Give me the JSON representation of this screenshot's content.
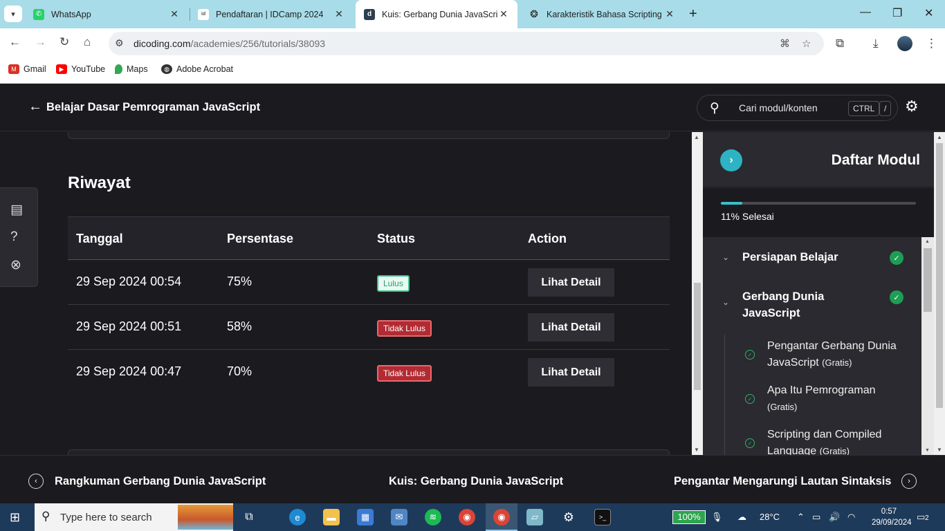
{
  "browser": {
    "tabs": [
      {
        "title": "WhatsApp",
        "icon": "whatsapp-icon",
        "active": false
      },
      {
        "title": "Pendaftaran | IDCamp 2024",
        "icon": "idcamp-icon",
        "active": false
      },
      {
        "title": "Kuis: Gerbang Dunia JavaScript",
        "icon": "dicoding-icon",
        "active": true
      },
      {
        "title": "Karakteristik Bahasa Scripting",
        "icon": "openai-icon",
        "active": false
      }
    ],
    "url_host": "dicoding.com",
    "url_path": "/academies/256/tutorials/38093",
    "bookmarks": [
      {
        "label": "Gmail",
        "icon": "gmail-icon",
        "color": "#d93025"
      },
      {
        "label": "YouTube",
        "icon": "youtube-icon",
        "color": "#ff0000"
      },
      {
        "label": "Maps",
        "icon": "maps-icon",
        "color": "#34a853"
      },
      {
        "label": "Adobe Acrobat",
        "icon": "globe-icon",
        "color": "#333333"
      }
    ]
  },
  "header": {
    "course_title": "Belajar Dasar Pemrograman JavaScript",
    "search_placeholder": "Cari modul/konten",
    "kbd_ctrl": "CTRL",
    "kbd_slash": "/"
  },
  "history": {
    "title": "Riwayat",
    "columns": [
      "Tanggal",
      "Persentase",
      "Status",
      "Action"
    ],
    "rows": [
      {
        "date": "29 Sep 2024 00:54",
        "percent": "75%",
        "status": "Lulus",
        "passed": true,
        "action": "Lihat Detail"
      },
      {
        "date": "29 Sep 2024 00:51",
        "percent": "58%",
        "status": "Tidak Lulus",
        "passed": false,
        "action": "Lihat Detail"
      },
      {
        "date": "29 Sep 2024 00:47",
        "percent": "70%",
        "status": "Tidak Lulus",
        "passed": false,
        "action": "Lihat Detail"
      }
    ]
  },
  "sidebar": {
    "title": "Daftar Modul",
    "progress": 0.11,
    "progress_label": "11% Selesai",
    "modules": [
      {
        "name": "Persiapan Belajar",
        "done": true
      },
      {
        "name": "Gerbang Dunia JavaScript",
        "done": true
      }
    ],
    "submodules": [
      {
        "name": "Pengantar Gerbang Dunia JavaScript",
        "tag": "(Gratis)"
      },
      {
        "name": "Apa Itu Pemrograman",
        "tag": "(Gratis)"
      },
      {
        "name": "Scripting dan Compiled Language",
        "tag": "(Gratis)"
      }
    ]
  },
  "footer_nav": {
    "prev": "Rangkuman Gerbang Dunia JavaScript",
    "current": "Kuis: Gerbang Dunia JavaScript",
    "next": "Pengantar Mengarungi Lautan Sintaksis"
  },
  "taskbar": {
    "search_placeholder": "Type here to search",
    "battery": "100%",
    "weather": "28°C",
    "time": "0:57",
    "date": "29/09/2024",
    "notifications": "2",
    "colors": {
      "accent": "#2db3c4",
      "pass": "#3ec48a",
      "fail": "#b22b33"
    }
  }
}
